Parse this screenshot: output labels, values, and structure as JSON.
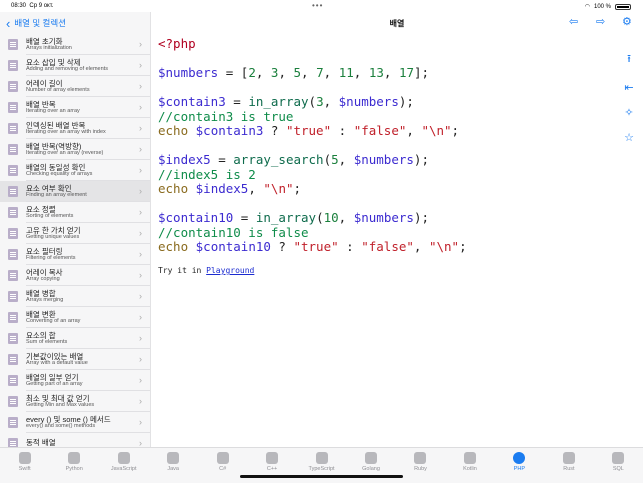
{
  "status": {
    "time": "08:30",
    "date": "Ср 9 окт.",
    "battery": "100 %",
    "dots": "•••"
  },
  "sidebar": {
    "back_label": "배열 및 컬렉션",
    "items": [
      {
        "ko": "배열 초기화",
        "en": "Arrays initialization"
      },
      {
        "ko": "요소 삽입 및 삭제",
        "en": "Adding and removing of elements"
      },
      {
        "ko": "어레이 길이",
        "en": "Number of array elements"
      },
      {
        "ko": "배열 반복",
        "en": "Iterating over an array"
      },
      {
        "ko": "인덱싱된 배열 반복",
        "en": "Iterating over an array with index"
      },
      {
        "ko": "배열 반복(역방향)",
        "en": "Iterating over an array (reverse)"
      },
      {
        "ko": "배열의 동일성 확인",
        "en": "Checking equality of arrays"
      },
      {
        "ko": "요소 여부 확인",
        "en": "Finding an array element"
      },
      {
        "ko": "요소 정렬",
        "en": "Sorting of elements"
      },
      {
        "ko": "고유 한 가치 얻기",
        "en": "Getting unique values"
      },
      {
        "ko": "요소 필터링",
        "en": "Filtering of elements"
      },
      {
        "ko": "어레이 복사",
        "en": "Array copying"
      },
      {
        "ko": "배열 병합",
        "en": "Arrays merging"
      },
      {
        "ko": "배열 변환",
        "en": "Converting of an array"
      },
      {
        "ko": "요소의 합",
        "en": "Sum of elements"
      },
      {
        "ko": "기본값이있는 배열",
        "en": "Array with a default value"
      },
      {
        "ko": "배열의 일부 얻기",
        "en": "Getting part of an array"
      },
      {
        "ko": "최소 및 최대 값 얻기",
        "en": "Getting Min and Max values"
      },
      {
        "ko": "every () 및 some () 메서드",
        "en": "every() and some() methods"
      },
      {
        "ko": "동적 배열",
        "en": ""
      }
    ]
  },
  "detail": {
    "title": "배열",
    "code": {
      "l1": "<?php",
      "nums_var": "$numbers",
      "nums_rest": " = [",
      "nums": [
        "2",
        "3",
        "5",
        "7",
        "11",
        "13",
        "17"
      ],
      "c3_var": "$contain3",
      "fn_in_array": "in_array",
      "c3_num": "3",
      "c3_comment": "//contain3 is true",
      "echo": "echo",
      "true_str": "\"true\"",
      "false_str": "\"false\"",
      "nl_str": "\"\\n\"",
      "i5_var": "$index5",
      "fn_search": "array_search",
      "i5_num": "5",
      "i5_comment": "//index5 is 2",
      "c10_var": "$contain10",
      "c10_num": "10",
      "c10_comment": "//contain10 is false"
    },
    "try_it": "Try it in ",
    "playground": "Playground"
  },
  "tabs": [
    {
      "label": "Swift"
    },
    {
      "label": "Python"
    },
    {
      "label": "JavaScript"
    },
    {
      "label": "Java"
    },
    {
      "label": "C#"
    },
    {
      "label": "C++"
    },
    {
      "label": "TypeScript"
    },
    {
      "label": "Golang"
    },
    {
      "label": "Ruby"
    },
    {
      "label": "Kotlin"
    },
    {
      "label": "PHP"
    },
    {
      "label": "Rust"
    },
    {
      "label": "SQL"
    }
  ],
  "selected_index": 7,
  "active_tab": "PHP",
  "colors": {
    "accent": "#1b7cf0"
  }
}
